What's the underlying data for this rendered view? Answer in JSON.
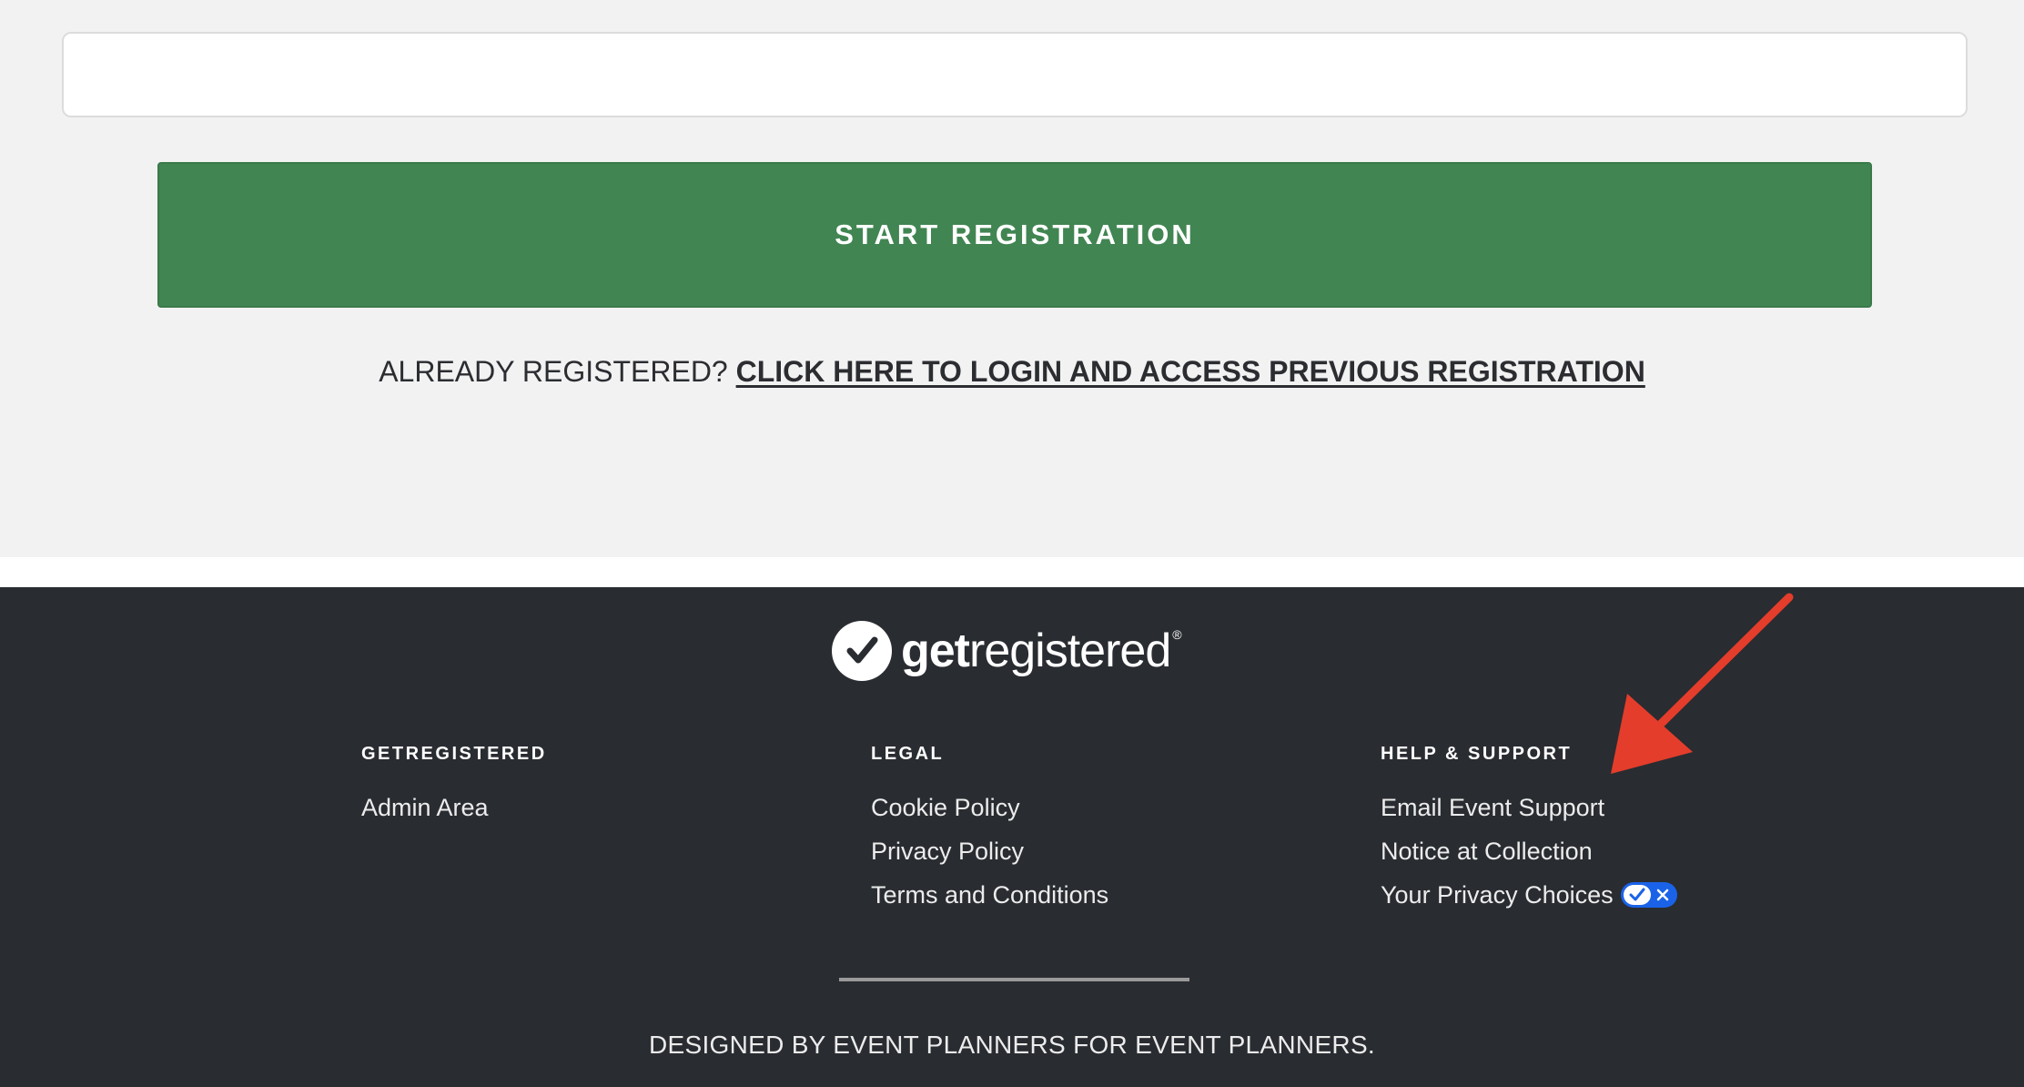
{
  "main": {
    "start_button_label": "START REGISTRATION",
    "already_text": "ALREADY REGISTERED? ",
    "login_link_label": "CLICK HERE TO LOGIN AND ACCESS PREVIOUS REGISTRATION"
  },
  "footer": {
    "logo": {
      "bold_part": "get",
      "light_part": "registered",
      "trademark": "®"
    },
    "columns": [
      {
        "heading": "GETREGISTERED",
        "links": [
          "Admin Area"
        ]
      },
      {
        "heading": "LEGAL",
        "links": [
          "Cookie Policy",
          "Privacy Policy",
          "Terms and Conditions"
        ]
      },
      {
        "heading": "HELP & SUPPORT",
        "links": [
          "Email Event Support",
          "Notice at Collection",
          "Your Privacy Choices"
        ]
      }
    ],
    "tagline": "DESIGNED BY EVENT PLANNERS FOR EVENT PLANNERS."
  },
  "annotations": {
    "arrow_icon": "red-arrow-icon"
  },
  "colors": {
    "button_green": "#418552",
    "footer_bg": "#292c31",
    "page_bg": "#f2f2f2",
    "privacy_toggle_blue": "#1a63e8",
    "annotation_red": "#e43d2b"
  }
}
